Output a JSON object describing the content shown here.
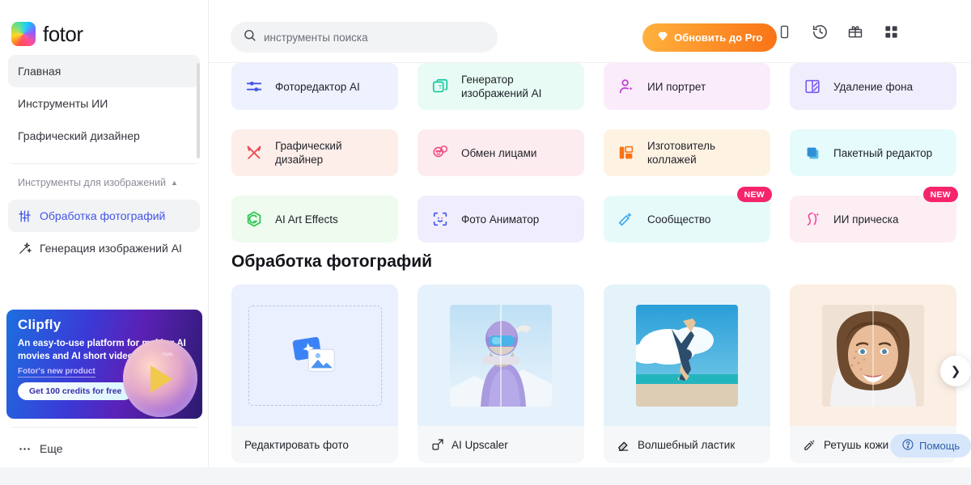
{
  "brand": {
    "name": "fotor",
    "logo_icon": "fotor-logo-icon"
  },
  "sidebar": {
    "items": [
      {
        "label": "Главная",
        "icon": "",
        "active": true
      },
      {
        "label": "Инструменты ИИ",
        "icon": "",
        "active": false
      },
      {
        "label": "Графический дизайнер",
        "icon": "",
        "active": false
      }
    ],
    "group": {
      "label": "Инструменты для изображений",
      "caret_icon": "chevron-up-icon"
    },
    "group_items": [
      {
        "label": "Обработка фотографий",
        "icon": "sliders-icon",
        "active": true
      },
      {
        "label": "Генерация изображений AI",
        "icon": "magic-wand-icon",
        "active": false
      }
    ],
    "more": {
      "label": "Еще",
      "icon": "ellipsis-icon"
    }
  },
  "promo": {
    "title": "Clipfly",
    "subtitle": "An easy-to-use platform for making AI movies and AI short videos! ✨",
    "link": "Fotor's new product",
    "button": "Get 100 credits for free",
    "orb_tag": "Clipfly",
    "play_icon": "play-icon"
  },
  "header": {
    "search": {
      "placeholder": "инструменты поиска",
      "value": "",
      "icon": "search-icon"
    },
    "pro_button": {
      "label": "Обновить до Pro",
      "icon": "diamond-icon",
      "color": "#f97316"
    },
    "icons": [
      {
        "name": "mobile-icon"
      },
      {
        "name": "history-icon"
      },
      {
        "name": "gift-icon"
      },
      {
        "name": "grid-apps-icon"
      }
    ],
    "avatar": {
      "name": "user-avatar"
    }
  },
  "tools": [
    {
      "label": "Фоторедактор AI",
      "icon": "sliders-icon",
      "bg": "#eef1fe",
      "badge": ""
    },
    {
      "label": "Генератор изображений AI",
      "icon": "image-gen-icon",
      "bg": "#e8fbf4",
      "badge": ""
    },
    {
      "label": "ИИ портрет",
      "icon": "portrait-icon",
      "bg": "#fbecfb",
      "badge": ""
    },
    {
      "label": "Удаление фона",
      "icon": "bg-remove-icon",
      "bg": "#f0eefd",
      "badge": ""
    },
    {
      "label": "Графический дизайнер",
      "icon": "design-tools-icon",
      "bg": "#fdeeea",
      "badge": ""
    },
    {
      "label": "Обмен лицами",
      "icon": "face-swap-icon",
      "bg": "#fdecef",
      "badge": ""
    },
    {
      "label": "Изготовитель коллажей",
      "icon": "collage-icon",
      "bg": "#fef3e3",
      "badge": ""
    },
    {
      "label": "Пакетный редактор",
      "icon": "batch-edit-icon",
      "bg": "#e6fbfb",
      "badge": ""
    },
    {
      "label": "AI Art Effects",
      "icon": "art-effects-icon",
      "bg": "#eefbee",
      "badge": ""
    },
    {
      "label": "Фото Аниматор",
      "icon": "photo-animator-icon",
      "bg": "#f0eefd",
      "badge": ""
    },
    {
      "label": "Сообщество",
      "icon": "community-icon",
      "bg": "#e6fafa",
      "badge": "NEW"
    },
    {
      "label": "ИИ прическа",
      "icon": "hairstyle-icon",
      "bg": "#fdeef3",
      "badge": "NEW"
    }
  ],
  "section": {
    "title": "Обработка фотографий"
  },
  "gallery": [
    {
      "label": "Редактировать фото",
      "icon": "",
      "thumb": "upload-placeholder"
    },
    {
      "label": "AI Upscaler",
      "icon": "upscale-icon",
      "thumb": "skier-photo"
    },
    {
      "label": "Волшебный ластик",
      "icon": "eraser-icon",
      "thumb": "beach-handstand-photo"
    },
    {
      "label": "Ретушь кожи AI",
      "icon": "skin-retouch-icon",
      "thumb": "portrait-photo"
    }
  ],
  "carousel": {
    "next_icon": "chevron-right-icon"
  },
  "help": {
    "label": "Помощь",
    "icon": "question-circle-icon"
  }
}
